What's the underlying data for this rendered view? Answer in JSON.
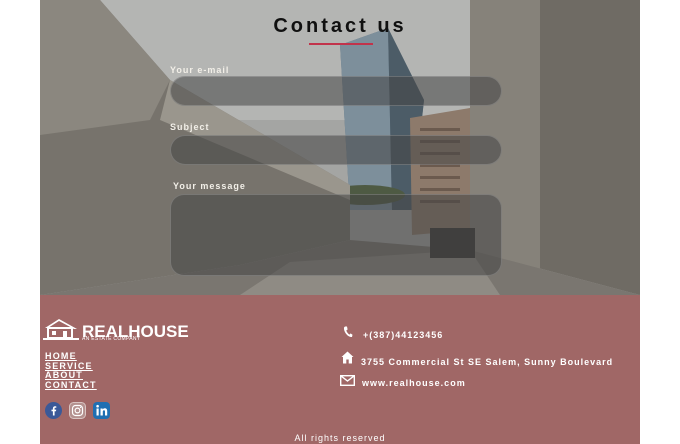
{
  "contact": {
    "title": "Contact us",
    "email_label": "Your e-mail",
    "subject_label": "Subject",
    "message_label": "Your message",
    "email_value": "",
    "subject_value": "",
    "message_value": ""
  },
  "footer": {
    "logo_name": "REALHOUSE",
    "logo_tagline": "AN ESTATE COMPANY",
    "nav": [
      "HOME",
      "SERVICE",
      "ABOUT",
      "CONTACT"
    ],
    "phone": "+(387)44123456",
    "address": "3755 Commercial St SE Salem, Sunny Boulevard",
    "website": "www.realhouse.com",
    "social": [
      "facebook-icon",
      "instagram-icon",
      "linkedin-icon"
    ],
    "copyright": "All rights reserved"
  },
  "colors": {
    "accent": "#c2334b",
    "footer_bg": "#a06766"
  }
}
